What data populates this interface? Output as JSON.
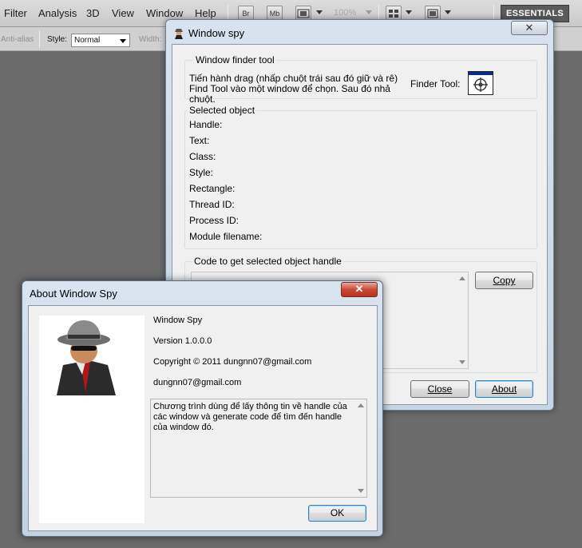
{
  "host": {
    "menu": [
      "Filter",
      "Analysis",
      "3D",
      "View",
      "Window",
      "Help"
    ],
    "toolbar_buttons": [
      "Br",
      "Mb"
    ],
    "zoom": "100%",
    "workspace_label": "ESSENTIALS",
    "options": {
      "antialias": "Anti-alias",
      "style_label": "Style:",
      "style_value": "Normal",
      "width_label": "Width:"
    }
  },
  "spy": {
    "title": "Window spy",
    "close": "✕",
    "finder_group": "Window finder tool",
    "finder_instructions": "Tiến hành drag (nhấp chuột trái sau đó giữ và rê) Find Tool vào một window để chọn. Sau đó nhả chuột.",
    "finder_tool_label": "Finder Tool:",
    "selected_group": "Selected object",
    "fields": [
      "Handle:",
      "Text:",
      "Class:",
      "Style:",
      "Rectangle:",
      "Thread ID:",
      "Process ID:",
      "Module filename:"
    ],
    "code_group": "Code to get selected object handle",
    "copy_button": "Copy",
    "close_button": "Close",
    "about_button": "About"
  },
  "about": {
    "title": "About Window Spy",
    "close": "✕",
    "product": "Window Spy",
    "version": "Version 1.0.0.0",
    "copyright": "Copyright ©  2011 dungnn07@gmail.com",
    "email": "dungnn07@gmail.com",
    "description": "Chương trình dùng để lấy thông tin về handle của các window và generate code để tìm đến handle của window đó.",
    "ok_button": "OK"
  }
}
